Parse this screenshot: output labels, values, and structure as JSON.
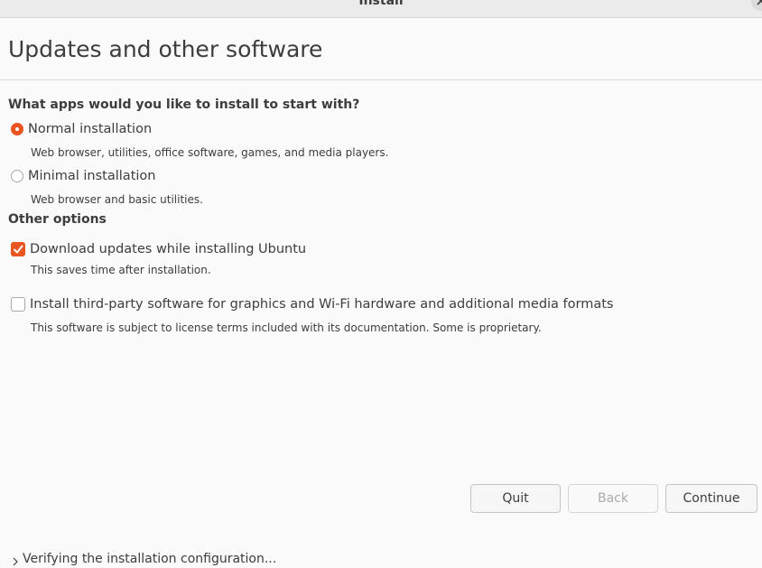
{
  "window": {
    "title": "Install"
  },
  "page": {
    "title": "Updates and other software"
  },
  "install_type": {
    "heading": "What apps would you like to install to start with?",
    "options": [
      {
        "label": "Normal installation",
        "description": "Web browser, utilities, office software, games, and media players.",
        "selected": true
      },
      {
        "label": "Minimal installation",
        "description": "Web browser and basic utilities.",
        "selected": false
      }
    ]
  },
  "other_options": {
    "heading": "Other options",
    "items": [
      {
        "label": "Download updates while installing Ubuntu",
        "description": "This saves time after installation.",
        "checked": true
      },
      {
        "label": "Install third-party software for graphics and Wi-Fi hardware and additional media formats",
        "description": "This software is subject to license terms included with its documentation. Some is proprietary.",
        "checked": false
      }
    ]
  },
  "buttons": {
    "quit": "Quit",
    "back": "Back",
    "continue": "Continue"
  },
  "status": {
    "text": "Verifying the installation configuration..."
  },
  "colors": {
    "accent": "#e95420",
    "background": "#fafafa",
    "text": "#3d3d3d"
  }
}
